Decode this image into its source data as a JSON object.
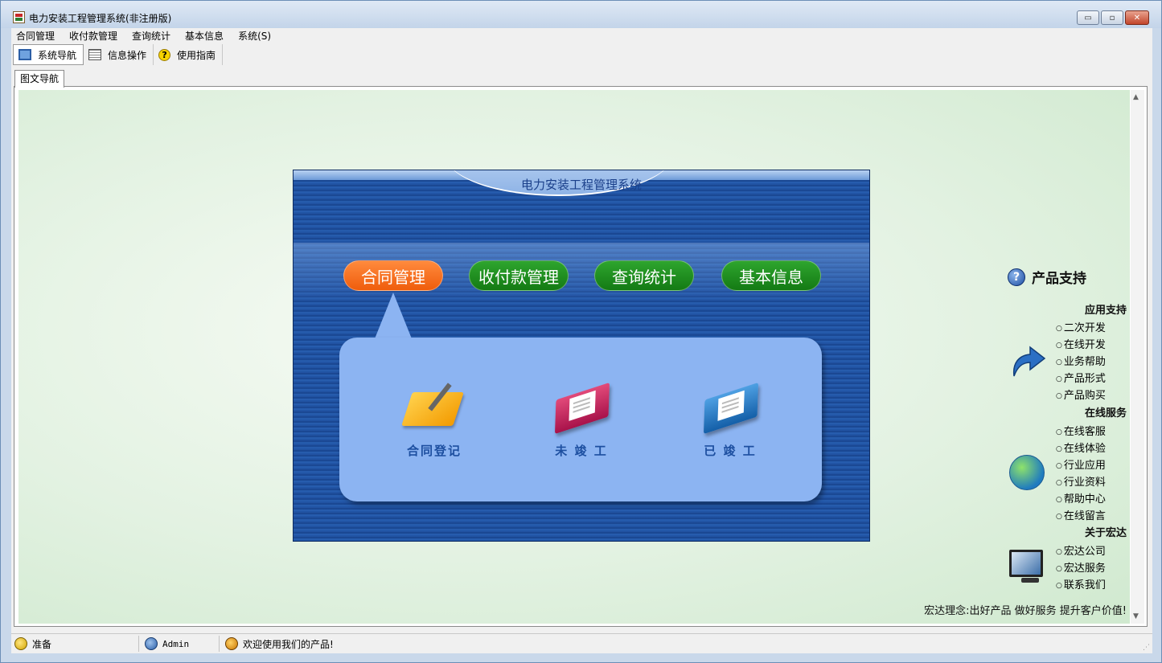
{
  "window": {
    "title": "电力安装工程管理系统(非注册版)",
    "controls": {
      "minimize": "▭",
      "maximize": "▫",
      "close": "✕"
    }
  },
  "menubar": {
    "items": [
      "合同管理",
      "收付款管理",
      "查询统计",
      "基本信息",
      "系统(S)"
    ]
  },
  "toolbar": {
    "buttons": [
      {
        "label": "系统导航",
        "icon": "monitor-icon",
        "active": true
      },
      {
        "label": "信息操作",
        "icon": "grid-icon",
        "active": false
      },
      {
        "label": "使用指南",
        "icon": "help-icon",
        "active": false
      }
    ]
  },
  "tabs": {
    "active": "图文导航"
  },
  "panel": {
    "title": "电力安装工程管理系统",
    "nav": [
      "合同管理",
      "收付款管理",
      "查询统计",
      "基本信息"
    ],
    "active_nav": "合同管理",
    "sub_items": [
      "合同登记",
      "未 竣 工",
      "已 竣 工"
    ]
  },
  "support": {
    "heading": "产品支持",
    "sections": [
      {
        "title": "应用支持",
        "icon": "arrow-icon",
        "links": [
          "二次开发",
          "在线开发",
          "业务帮助",
          "产品形式",
          "产品购买"
        ]
      },
      {
        "title": "在线服务",
        "icon": "globe-icon",
        "links": [
          "在线客服",
          "在线体验",
          "行业应用",
          "行业资料",
          "帮助中心",
          "在线留言"
        ]
      },
      {
        "title": "关于宏达",
        "icon": "monitor-icon",
        "links": [
          "宏达公司",
          "宏达服务",
          "联系我们"
        ]
      }
    ],
    "motto": "宏达理念:出好产品 做好服务 提升客户价值!"
  },
  "statusbar": {
    "ready": "准备",
    "user": "Admin",
    "welcome": "欢迎使用我们的产品!"
  },
  "colors": {
    "orange_pill": "#ef5d0c",
    "green_pill": "#147a14",
    "panel_blue": "#1d4f9f",
    "bubble": "#8cb4f2"
  }
}
